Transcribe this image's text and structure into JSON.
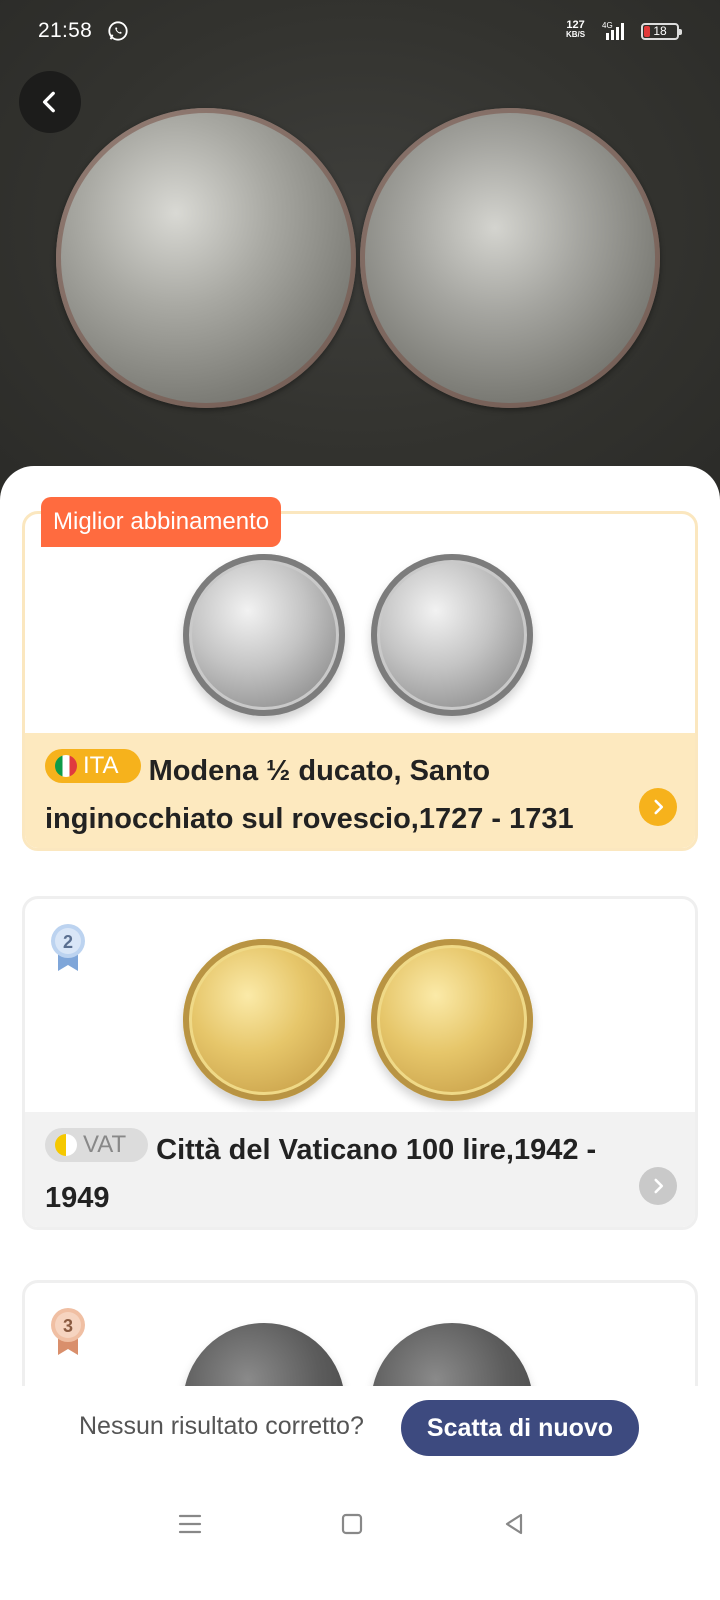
{
  "status_bar": {
    "time": "21:58",
    "net_speed_value": "127",
    "net_speed_unit": "KB/S",
    "network_type": "4G",
    "battery": "18",
    "battery_level": 0.18
  },
  "header": {
    "back_icon": "chevron-left-icon"
  },
  "results": {
    "best_badge": "Miglior abbinamento",
    "items": [
      {
        "rank": "1",
        "country_code": "ITA",
        "title": "Modena ½ ducato, Santo inginocchiato sul rovescio,1727 - 1731",
        "metal": "silver"
      },
      {
        "rank": "2",
        "country_code": "VAT",
        "title": "Città del Vaticano 100 lire,1942 - 1949",
        "metal": "gold"
      },
      {
        "rank": "3",
        "metal": "bronze"
      }
    ]
  },
  "footer": {
    "no_result_text": "Nessun risultato corretto?",
    "retake_label": "Scatta di nuovo"
  },
  "colors": {
    "accent_orange": "#ff6b3f",
    "pill_yellow": "#f6b21c",
    "best_info_bg": "#fde9bf",
    "retake_button": "#3d4a7f"
  }
}
